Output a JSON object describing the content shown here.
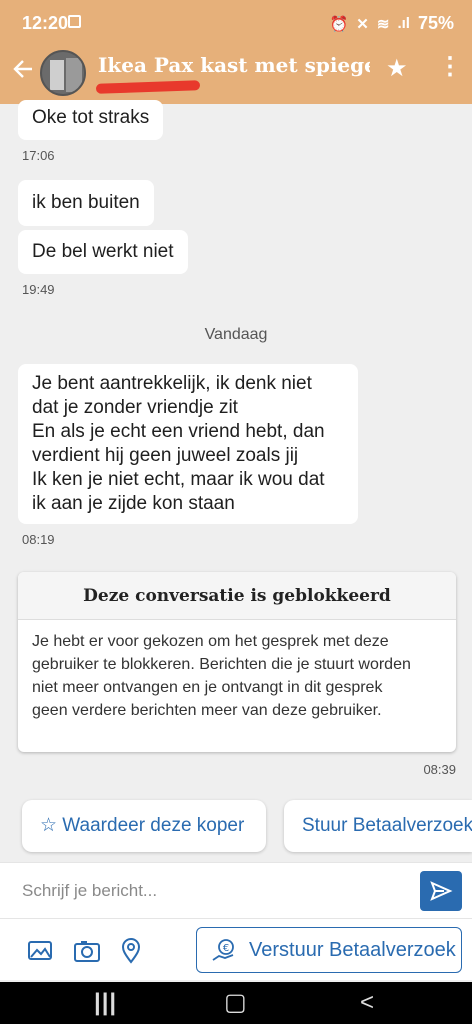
{
  "status_bar": {
    "time": "12:20",
    "battery": "75%"
  },
  "header": {
    "title": "Ikea Pax kast met spiege..."
  },
  "messages": [
    {
      "text": "Oke tot straks"
    },
    {
      "text": "ik ben buiten"
    },
    {
      "text": "De bel werkt niet"
    },
    {
      "lines": [
        "Je bent aantrekkelijk, ik denk niet",
        "dat je zonder vriendje zit",
        "En als je echt een vriend hebt, dan",
        "verdient hij geen juweel zoals jij",
        "Ik ken je niet echt, maar ik wou dat",
        "ik aan je zijde kon staan"
      ]
    }
  ],
  "timestamps": [
    "17:06",
    "19:49",
    "08:19",
    "08:39"
  ],
  "day_separator": "Vandaag",
  "blocked_notice": {
    "title": "Deze conversatie is geblokkeerd",
    "lines": [
      "Je hebt er voor gekozen om het gesprek met deze",
      "gebruiker te blokkeren. Berichten die je stuurt worden",
      "niet meer ontvangen en je ontvangt in dit gesprek",
      "geen verdere berichten meer van deze gebruiker."
    ]
  },
  "actions": {
    "rate": "☆ Waardeer deze koper",
    "payment": "Stuur Betaalverzoek"
  },
  "composer": {
    "placeholder": "Schrijf je bericht..."
  },
  "toolbar": {
    "payment_request": "Verstuur Betaalverzoek"
  },
  "icons": [
    "back-arrow-icon",
    "star-icon",
    "more-vert-icon",
    "send-icon",
    "gallery-icon",
    "camera-icon",
    "location-pin-icon",
    "hand-coin-icon"
  ],
  "colors": {
    "header": "#e6b07a",
    "accent": "#2a6bb0",
    "redline": "#e8392c"
  }
}
